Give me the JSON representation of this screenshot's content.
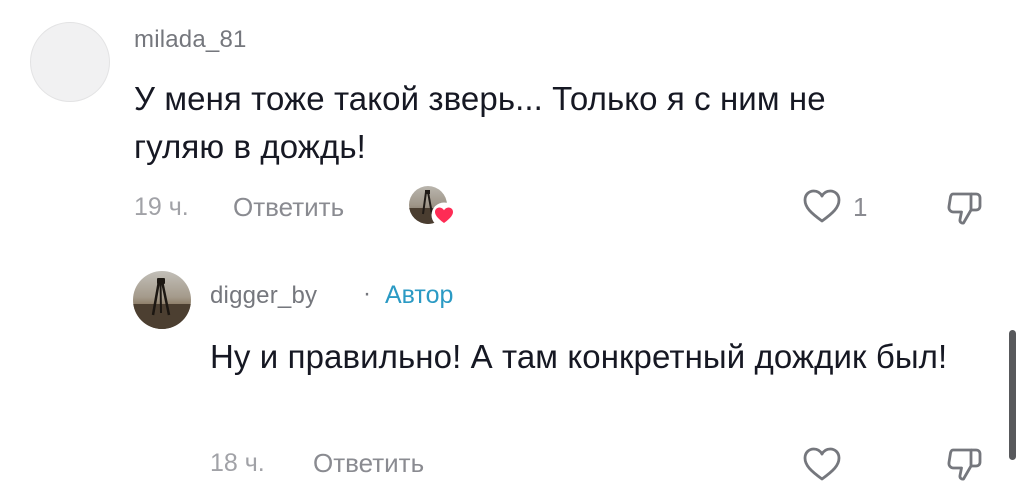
{
  "comments": [
    {
      "username": "milada_81",
      "text": "У меня тоже такой зверь... Только я с ним не гуляю в дождь!",
      "time": "19 ч.",
      "reply_label": "Ответить",
      "like_count": "1",
      "liked_by_creator": true
    }
  ],
  "replies": [
    {
      "username": "digger_by",
      "separator": "·",
      "author_tag": "Автор",
      "text": "Ну и правильно! А там конкретный дождик был!",
      "time": "18 ч.",
      "reply_label": "Ответить"
    }
  ],
  "icons": {
    "like": "heart-outline-icon",
    "dislike": "thumbs-down-outline-icon",
    "creator_like_badge": "heart-filled-icon"
  },
  "colors": {
    "text_primary": "#161823",
    "text_secondary": "#75777d",
    "author_tag": "#2b9ac4",
    "heart_badge": "#fe2c55",
    "icon_gray": "#75777d"
  }
}
